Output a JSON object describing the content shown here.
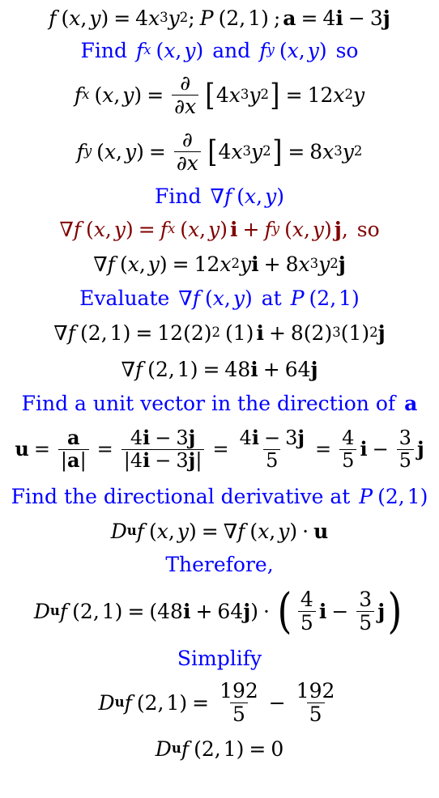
{
  "document": {
    "type": "math-worked-solution",
    "topic": "Directional derivative",
    "background_color": "#ffffff",
    "colors": {
      "black": "#000000",
      "blue": "#0000ff",
      "maroon": "#800000"
    }
  },
  "lines": [
    {
      "id": "problem-statement",
      "role": "math",
      "color": "black",
      "text": "f (x, y) = 4x³y²; P (2, 1) ; a = 4i − 3j"
    },
    {
      "id": "instruction-find-partials",
      "role": "prose",
      "color": "blue",
      "text": "Find  fx (x, y)  and  fy (x, y)  so"
    },
    {
      "id": "partial-fx",
      "role": "math",
      "color": "black",
      "text": "fx (x, y) = ∂/∂x [4x³y²] = 12x²y"
    },
    {
      "id": "partial-fy",
      "role": "math",
      "color": "black",
      "text": "fy (x, y) = ∂/∂x [4x³y²] = 8x³y²"
    },
    {
      "id": "instruction-find-gradient",
      "role": "prose",
      "color": "blue",
      "text": "Find ∇f (x, y)"
    },
    {
      "id": "gradient-definition",
      "role": "math",
      "color": "maroon",
      "text": "∇f (x, y) = fx (x, y) i + fy (x, y) j,  so"
    },
    {
      "id": "gradient-result",
      "role": "math",
      "color": "black",
      "text": "∇f (x, y) = 12x²yi + 8x³y²j"
    },
    {
      "id": "instruction-evaluate-gradient",
      "role": "prose",
      "color": "blue",
      "text": "Evaluate ∇f (x, y)  at  P (2, 1)"
    },
    {
      "id": "gradient-substituted",
      "role": "math",
      "color": "black",
      "text": "∇f (2, 1) = 12(2)² (1) i + 8(2)³(1)²j"
    },
    {
      "id": "gradient-evaluated",
      "role": "math",
      "color": "black",
      "text": "∇f (2, 1) = 48i + 64j"
    },
    {
      "id": "instruction-find-unit-vector",
      "role": "prose",
      "color": "blue",
      "text": "Find a unit vector in the direction of a"
    },
    {
      "id": "unit-vector-computation",
      "role": "math",
      "color": "black",
      "text": "u = a/|a| = (4i − 3j)/|4i − 3j| = (4i − 3j)/5 = (4/5)i − (3/5)j"
    },
    {
      "id": "instruction-find-directional-derivative",
      "role": "prose",
      "color": "blue",
      "text": "Find the directional derivative at P (2, 1)"
    },
    {
      "id": "directional-derivative-definition",
      "role": "math",
      "color": "black",
      "text": "Duf (x, y) = ∇f (x, y) · u"
    },
    {
      "id": "instruction-therefore",
      "role": "prose",
      "color": "blue",
      "text": "Therefore,"
    },
    {
      "id": "directional-derivative-substituted",
      "role": "math",
      "color": "black",
      "text": "Duf (2, 1) = (48i + 64j) · ((4/5)i − (3/5)j)"
    },
    {
      "id": "instruction-simplify",
      "role": "prose",
      "color": "blue",
      "text": "Simplify"
    },
    {
      "id": "directional-derivative-expanded",
      "role": "math",
      "color": "black",
      "text": "Duf (2, 1) = 192/5 − 192/5"
    },
    {
      "id": "directional-derivative-final",
      "role": "math",
      "color": "black",
      "text": "Duf (2, 1) = 0"
    }
  ],
  "symbols": {
    "function_name": "f",
    "var_x": "x",
    "var_y": "y",
    "point_label": "P",
    "point_x": "2",
    "point_y": "1",
    "vector_a": "a",
    "unit_vector": "u",
    "gradient": "∇",
    "partial": "∂",
    "dot_operator": "·",
    "minus": "−",
    "plus": "+",
    "equals": "=",
    "i_hat": "i",
    "j_hat": "j",
    "coefficient_4": "4",
    "exponent_3": "3",
    "exponent_2": "2",
    "coefficient_12": "12",
    "coefficient_8": "8",
    "gradient_i_component": "48",
    "gradient_j_component": "64",
    "magnitude_a": "5",
    "unit_i_num": "4",
    "unit_j_num": "3",
    "unit_den": "5",
    "product_num": "192",
    "product_den": "5",
    "final_answer": "0",
    "word_find": "Find",
    "word_and": "and",
    "word_so": "so",
    "word_evaluate": "Evaluate",
    "word_at": "at",
    "word_find_a": "Find a unit vector in the direction of",
    "word_find_dir": "Find the directional derivative at",
    "word_therefore": "Therefore,",
    "word_simplify": "Simplify",
    "word_D": "D"
  }
}
